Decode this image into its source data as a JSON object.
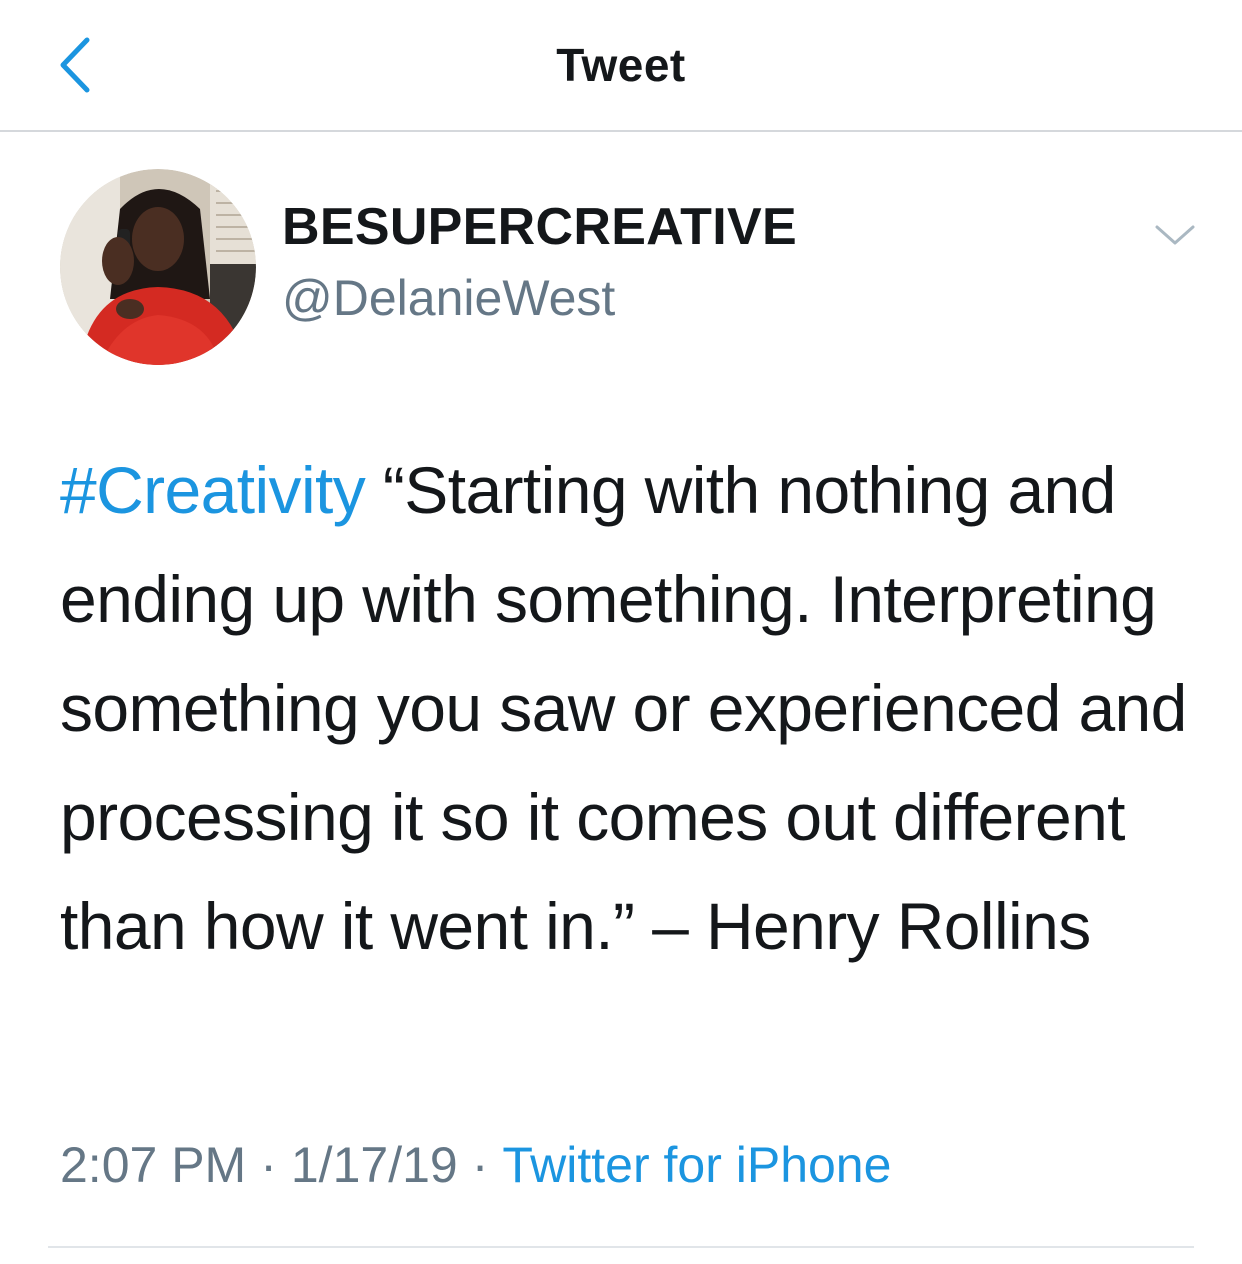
{
  "nav": {
    "title": "Tweet",
    "back_icon": "chevron-left-icon",
    "accent_color": "#1b95e0"
  },
  "author": {
    "display_name": "BESUPERCREATIVE",
    "handle": "@DelanieWest",
    "avatar_icon": "avatar-photo",
    "caret_icon": "chevron-down-icon"
  },
  "tweet": {
    "hashtag": "#Creativity",
    "body": " “Starting with nothing and ending up with something. Interpreting something you saw or experienced and processing it so it comes out different than how it went in.” – Henry Rollins"
  },
  "meta": {
    "time": "2:07 PM",
    "date": "1/17/19",
    "separator": "·",
    "source": "Twitter for iPhone"
  },
  "colors": {
    "text": "#14171a",
    "secondary": "#657786",
    "link": "#1b95e0",
    "divider": "#d5d8dc"
  }
}
